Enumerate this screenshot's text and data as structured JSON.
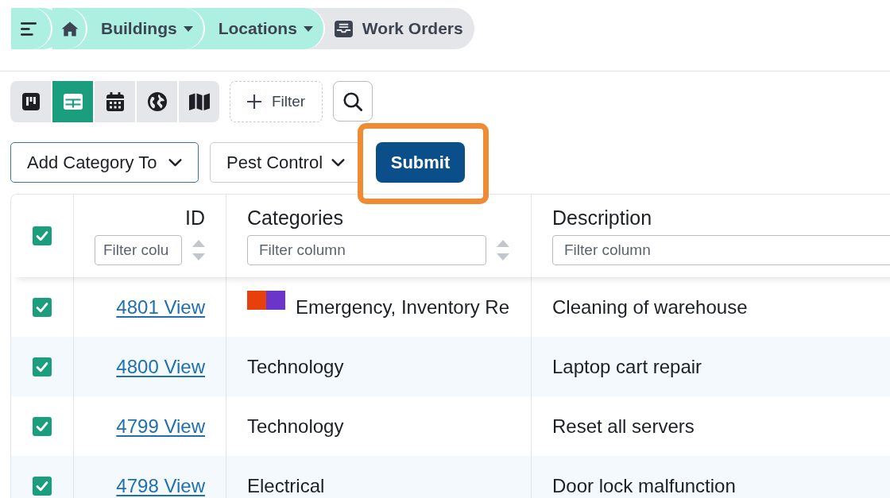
{
  "breadcrumb": [
    {
      "kind": "menu"
    },
    {
      "kind": "home"
    },
    {
      "kind": "dropdown",
      "label": "Buildings"
    },
    {
      "kind": "dropdown",
      "label": "Locations"
    },
    {
      "kind": "current",
      "label": "Work Orders"
    }
  ],
  "views": [
    {
      "kind": "board",
      "selected": false
    },
    {
      "kind": "table",
      "selected": true
    },
    {
      "kind": "calendar",
      "selected": false
    },
    {
      "kind": "globe",
      "selected": false
    },
    {
      "kind": "map",
      "selected": false
    }
  ],
  "filter_button": {
    "label": "Filter"
  },
  "bulk_edit": {
    "action": "Add Category To",
    "category": "Pest Control",
    "submit": {
      "label": "Submit",
      "highlighted": true
    }
  },
  "table": {
    "select_all": {
      "checked": true
    },
    "columns": [
      {
        "kind": "link",
        "label": "ID",
        "placeholder": "Filter colu",
        "sortable": true
      },
      {
        "kind": "categories",
        "label": "Categories",
        "placeholder": "Filter column",
        "sortable": true
      },
      {
        "kind": "text",
        "label": "Description",
        "placeholder": "Filter column"
      }
    ],
    "rows": [
      {
        "checked": true,
        "cells": [
          {
            "text": "4801 View"
          },
          {
            "text": "Emergency, Inventory Re",
            "swatches": [
              {
                "color": "#e8400c"
              },
              {
                "color": "#6a35c8"
              }
            ]
          },
          {
            "text": "Cleaning of warehouse"
          }
        ]
      },
      {
        "checked": true,
        "cells": [
          {
            "text": "4800 View"
          },
          {
            "text": "Technology"
          },
          {
            "text": "Laptop cart repair"
          }
        ]
      },
      {
        "checked": true,
        "cells": [
          {
            "text": "4799 View"
          },
          {
            "text": "Technology"
          },
          {
            "text": "Reset all servers"
          }
        ]
      },
      {
        "checked": true,
        "cells": [
          {
            "text": "4798 View"
          },
          {
            "text": "Electrical"
          },
          {
            "text": "Door lock malfunction"
          }
        ]
      }
    ]
  }
}
